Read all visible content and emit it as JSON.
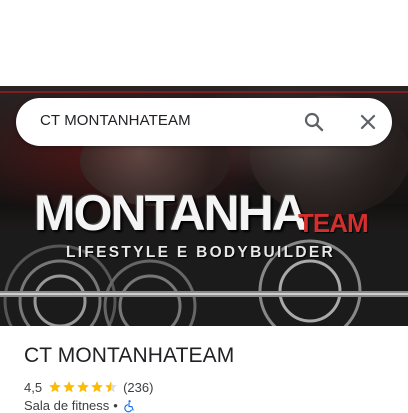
{
  "search": {
    "query": "CT MONTANHATEAM",
    "search_icon": "search-icon",
    "close_icon": "close-icon"
  },
  "hero": {
    "logo_main": "MONTANHA",
    "logo_team": "TEAM",
    "logo_subtitle": "LIFESTYLE E BODYBUILDER"
  },
  "place": {
    "name": "CT MONTANHATEAM",
    "rating": "4,5",
    "stars_value": 4.5,
    "review_count": "(236)",
    "category": "Sala de fitness",
    "separator": "•",
    "accessibility_icon": "wheelchair-icon"
  },
  "colors": {
    "star": "#fbbc04",
    "accessible": "#1a73e8",
    "logo_accent": "#d32f2f"
  }
}
